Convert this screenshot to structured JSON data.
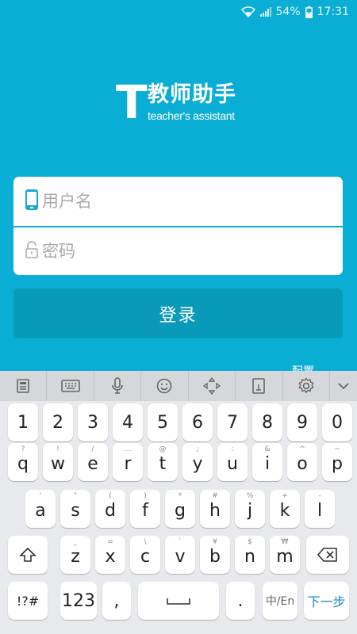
{
  "status": {
    "battery": "54%",
    "time": "17:31"
  },
  "logo": {
    "mark": "T",
    "title": "教师助手",
    "subtitle": "teacher's assistant"
  },
  "form": {
    "username_placeholder": "用户名",
    "password_placeholder": "密码",
    "login_label": "登录",
    "config_label": "配置"
  },
  "keyboard": {
    "toolbar": [
      "clipboard-icon",
      "keyboard-icon",
      "microphone-icon",
      "emoji-icon",
      "cursor-move-icon",
      "handwriting-icon",
      "settings-icon",
      "chevron-down-icon"
    ],
    "numbers": [
      "1",
      "2",
      "3",
      "4",
      "5",
      "6",
      "7",
      "8",
      "9",
      "0"
    ],
    "row1": [
      {
        "k": "q",
        "h": "?"
      },
      {
        "k": "w",
        "h": "!"
      },
      {
        "k": "e",
        "h": "/"
      },
      {
        "k": "r",
        "h": "…"
      },
      {
        "k": "t",
        "h": "@"
      },
      {
        "k": "y",
        "h": ";"
      },
      {
        "k": "u",
        "h": ":"
      },
      {
        "k": "i",
        "h": "&"
      },
      {
        "k": "o",
        "h": "^"
      },
      {
        "k": "p",
        "h": "~"
      }
    ],
    "row2": [
      {
        "k": "a",
        "h": "'"
      },
      {
        "k": "s",
        "h": "\""
      },
      {
        "k": "d",
        "h": "("
      },
      {
        "k": "f",
        "h": ")"
      },
      {
        "k": "g",
        "h": "*"
      },
      {
        "k": "h",
        "h": "#"
      },
      {
        "k": "j",
        "h": "%"
      },
      {
        "k": "k",
        "h": "+"
      },
      {
        "k": "l",
        "h": "-"
      }
    ],
    "row3": [
      {
        "k": "z",
        "h": "_"
      },
      {
        "k": "x",
        "h": "="
      },
      {
        "k": "c",
        "h": "\\"
      },
      {
        "k": "v",
        "h": "`"
      },
      {
        "k": "b",
        "h": "¥"
      },
      {
        "k": "n",
        "h": "$"
      },
      {
        "k": "m",
        "h": "₩"
      }
    ],
    "symbols_label": "!?#",
    "numeric_label": "123",
    "comma": ",",
    "period": ".",
    "lang_label": "中/En",
    "next_label": "下一步"
  }
}
